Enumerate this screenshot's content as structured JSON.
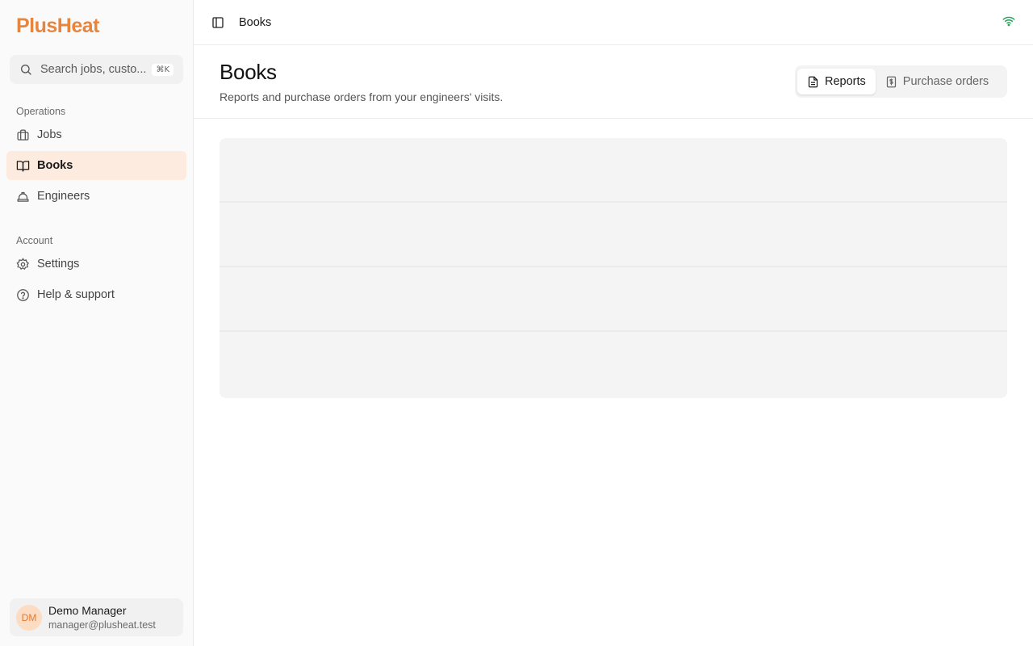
{
  "brand": {
    "logo": "PlusHeat",
    "accent": "#e8853d"
  },
  "search": {
    "placeholder": "Search jobs, custo...",
    "shortcut": "⌘K"
  },
  "sidebar": {
    "sections": [
      {
        "label": "Operations",
        "items": [
          {
            "label": "Jobs",
            "icon": "briefcase-icon",
            "active": false
          },
          {
            "label": "Books",
            "icon": "book-open-icon",
            "active": true
          },
          {
            "label": "Engineers",
            "icon": "hard-hat-icon",
            "active": false
          }
        ]
      },
      {
        "label": "Account",
        "items": [
          {
            "label": "Settings",
            "icon": "gear-icon",
            "active": false
          },
          {
            "label": "Help & support",
            "icon": "help-circle-icon",
            "active": false
          }
        ]
      }
    ]
  },
  "user": {
    "initials": "DM",
    "name": "Demo Manager",
    "email": "manager@plusheat.test"
  },
  "topbar": {
    "breadcrumb": "Books",
    "status_color": "#22a35a"
  },
  "page": {
    "title": "Books",
    "subtitle": "Reports and purchase orders from your engineers' visits.",
    "tabs": [
      {
        "label": "Reports",
        "icon": "file-text-icon",
        "active": true
      },
      {
        "label": "Purchase orders",
        "icon": "receipt-icon",
        "active": false
      }
    ]
  }
}
